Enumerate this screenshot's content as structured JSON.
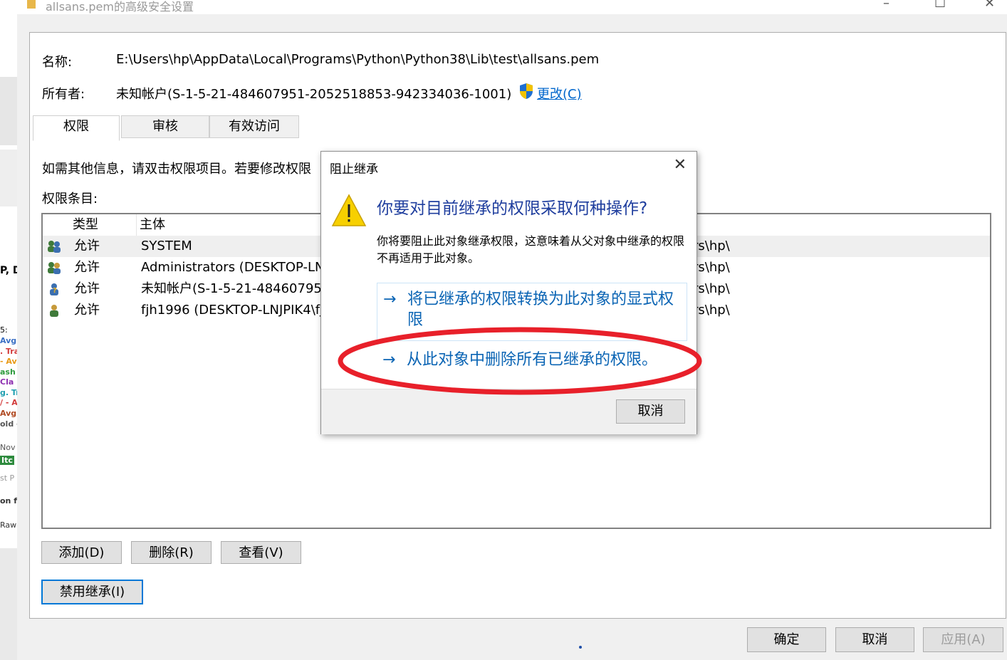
{
  "window": {
    "title": "allsans.pem的高级安全设置",
    "name_label": "名称:",
    "name_value": "E:\\Users\\hp\\AppData\\Local\\Programs\\Python\\Python38\\Lib\\test\\allsans.pem",
    "owner_label": "所有者:",
    "owner_value": "未知帐户(S-1-5-21-484607951-2052518853-942334036-1001)",
    "change_link": "更改(C)"
  },
  "tabs": [
    {
      "label": "权限",
      "selected": true
    },
    {
      "label": "审核",
      "selected": false
    },
    {
      "label": "有效访问",
      "selected": false
    }
  ],
  "content": {
    "info_text": "如需其他信息，请双击权限项目。若要修改权限",
    "entries_label": "权限条目:"
  },
  "permissions_table": {
    "headers": [
      "类型",
      "主体"
    ],
    "rows": [
      {
        "type": "允许",
        "principal": "SYSTEM",
        "inherited": "rs\\hp\\"
      },
      {
        "type": "允许",
        "principal": "Administrators (DESKTOP-LN",
        "inherited": "rs\\hp\\"
      },
      {
        "type": "允许",
        "principal": "未知帐户(S-1-5-21-48460795",
        "inherited": "rs\\hp\\"
      },
      {
        "type": "允许",
        "principal": "fjh1996 (DESKTOP-LNJPIK4\\fj",
        "inherited": "rs\\hp\\"
      }
    ]
  },
  "buttons": {
    "add": "添加(D)",
    "remove": "删除(R)",
    "view": "查看(V)",
    "disable_inheritance": "禁用继承(I)",
    "ok": "确定",
    "cancel": "取消",
    "apply": "应用(A)"
  },
  "dialog": {
    "title": "阻止继承",
    "heading": "你要对目前继承的权限采取何种操作?",
    "body": "你将要阻止此对象继承权限，这意味着从父对象中继承的权限不再适用于此对象。",
    "command1": "将已继承的权限转换为此对象的显式权限",
    "command2": "从此对象中删除所有已继承的权限。",
    "cancel": "取消",
    "arrow": "→"
  },
  "annotation": {
    "color": "#e8202a"
  },
  "left_fragments": [
    "P, Do",
    "5:",
    "Avg",
    ". Tra",
    "- Av",
    "ash",
    "Cla",
    "g. Tr",
    "/ - A",
    "Avg.",
    "old -",
    "Nov",
    "Itc",
    "st P",
    "on fe",
    "Raw"
  ]
}
